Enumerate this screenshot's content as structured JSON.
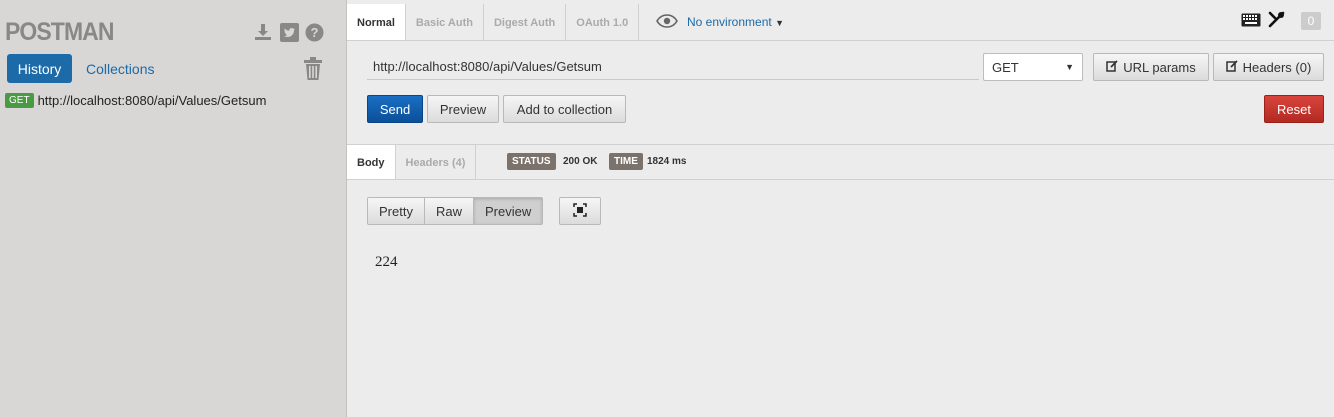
{
  "sidebar": {
    "logo": "POSTMAN",
    "tabs": {
      "history": "History",
      "collections": "Collections"
    },
    "history_items": [
      {
        "method": "GET",
        "url": "http://localhost:8080/api/Values/Getsum"
      }
    ],
    "icons": [
      "download-icon",
      "twitter-icon",
      "help-icon",
      "trash-icon"
    ]
  },
  "request": {
    "mode_tabs": [
      "Normal",
      "Basic Auth",
      "Digest Auth",
      "OAuth 1.0"
    ],
    "active_mode": "Normal",
    "environment": "No environment",
    "counter": "0",
    "url": "http://localhost:8080/api/Values/Getsum",
    "method": "GET",
    "url_params_label": "URL params",
    "headers_label": "Headers (0)",
    "send_label": "Send",
    "preview_label": "Preview",
    "add_collection_label": "Add to collection",
    "reset_label": "Reset"
  },
  "response": {
    "tabs": [
      "Body",
      "Headers (4)"
    ],
    "active_tab": "Body",
    "status_label": "STATUS",
    "status_value": "200 OK",
    "time_label": "TIME",
    "time_value": "1824 ms",
    "view_modes": [
      "Pretty",
      "Raw",
      "Preview"
    ],
    "active_view": "Preview",
    "body": "224"
  },
  "colors": {
    "primary": "#1c6aa8",
    "send": "#0b4f99",
    "reset": "#c0332b",
    "get_badge": "#4a9a43"
  }
}
